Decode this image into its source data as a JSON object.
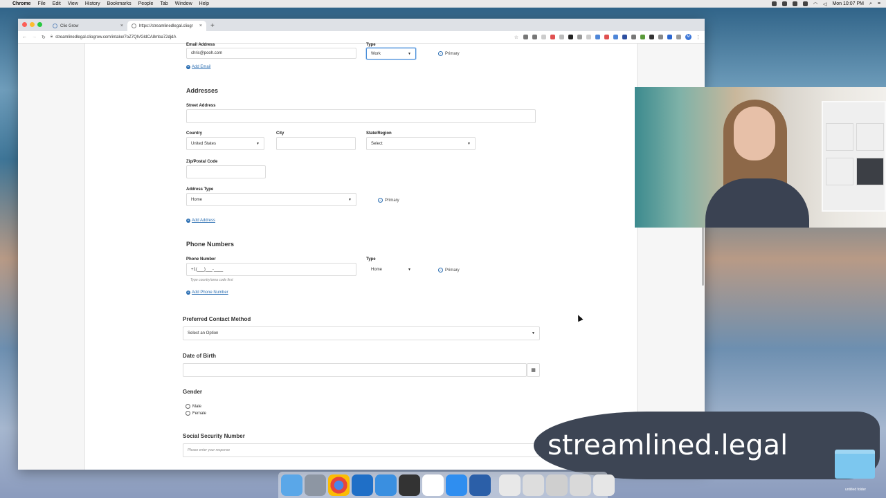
{
  "menubar": {
    "app": "Chrome",
    "items": [
      "File",
      "Edit",
      "View",
      "History",
      "Bookmarks",
      "People",
      "Tab",
      "Window",
      "Help"
    ],
    "clock": "Mon 10:07 PM"
  },
  "browser": {
    "tabs": [
      {
        "label": "Clio Grow"
      },
      {
        "label": "https://streamlinedlegal.cliogr"
      }
    ],
    "url": "streamlinedlegal.cliogrow.com/intake/7oZ7QlVGldCA8mba72djdA",
    "profile_initial": "M"
  },
  "form": {
    "email": {
      "label": "Email Address",
      "value": "chris@pooh.com",
      "type_label": "Type",
      "type_value": "Work",
      "primary": "Primary",
      "add_link": "Add Email"
    },
    "addresses": {
      "heading": "Addresses",
      "street_label": "Street Address",
      "street_value": "",
      "country_label": "Country",
      "country_value": "United States",
      "city_label": "City",
      "city_value": "",
      "state_label": "State/Region",
      "state_value": "Select",
      "zip_label": "Zip/Postal Code",
      "zip_value": "",
      "type_label": "Address Type",
      "type_value": "Home",
      "primary": "Primary",
      "add_link": "Add Address"
    },
    "phones": {
      "heading": "Phone Numbers",
      "number_label": "Phone Number",
      "number_value": "+1(___)___-____",
      "hint": "Type country/area code first",
      "type_label": "Type",
      "type_value": "Home",
      "primary": "Primary",
      "add_link": "Add Phone Number"
    },
    "contact_method": {
      "label": "Preferred Contact Method",
      "value": "Select an Option"
    },
    "dob": {
      "label": "Date of Birth",
      "value": ""
    },
    "gender": {
      "label": "Gender",
      "options": [
        "Male",
        "Female"
      ]
    },
    "ssn": {
      "label": "Social Security Number",
      "placeholder": "Please enter your response"
    }
  },
  "overlay": {
    "logo": "streamlined.legal",
    "desktop_folder": "untitled folder"
  },
  "colors": {
    "link": "#2c6fb3",
    "logo_bg": "#3d4554"
  }
}
